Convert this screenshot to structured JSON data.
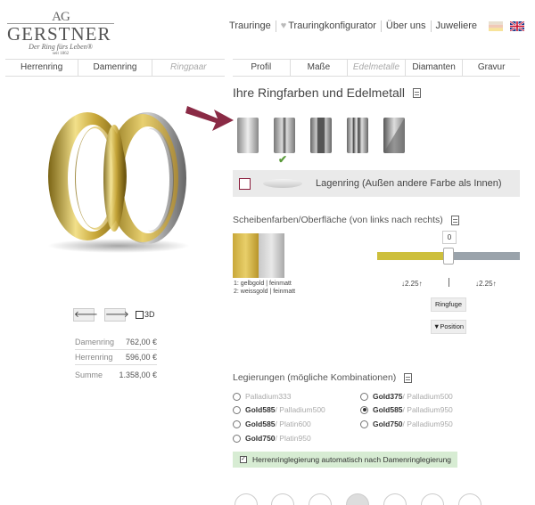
{
  "logo": {
    "monogram": "AG",
    "name": "GERSTNER",
    "tagline": "Der Ring fürs Leben®",
    "since": "seit 1862"
  },
  "topnav": {
    "items": [
      "Trauringe",
      "Trauringkonfigurator",
      "Über uns",
      "Juweliere"
    ]
  },
  "tabs_left": [
    "Herrenring",
    "Damenring",
    "Ringpaar"
  ],
  "tabs_right": [
    "Profil",
    "Maße",
    "Edelmetalle",
    "Diamanten",
    "Gravur"
  ],
  "controls": {
    "left_icon": "arrow-left-icon",
    "right_icon": "arrow-right-icon",
    "threed_label": "3D"
  },
  "prices": [
    {
      "label": "Damenring",
      "value": "762,00 €"
    },
    {
      "label": "Herrenring",
      "value": "596,00 €"
    },
    {
      "label": "Summe",
      "value": "1.358,00 €"
    }
  ],
  "metals": {
    "title": "Ihre Ringfarben und Edelmetall",
    "lagen_label": "Lagenring (Außen andere Farbe als Innen)",
    "disc_title": "Scheibenfarben/Oberfläche (von links nach rechts)",
    "legend": [
      "1: gelbgold | feinmatt",
      "2: weissgold | feinmatt"
    ],
    "slider_value": "0",
    "slider_split_fraction": 0.5,
    "left_width": "↓2.25↑",
    "right_width": "↓2.25↑",
    "ringfuge_label": "Ringfuge",
    "position_label": "▼Position",
    "colors": {
      "gold": "#cdbf3c",
      "white": "#9aa3ab",
      "accent": "#8a1d3c"
    }
  },
  "alloys": {
    "title": "Legierungen (mögliche Kombinationen)",
    "left": [
      {
        "main": "",
        "sec": "Palladium333",
        "selected": false
      },
      {
        "main": "Gold585",
        "sec": " / Palladium500",
        "selected": false
      },
      {
        "main": "Gold585",
        "sec": " / Platin600",
        "selected": false
      },
      {
        "main": "Gold750",
        "sec": " / Platin950",
        "selected": false
      }
    ],
    "right": [
      {
        "main": "Gold375",
        "sec": " / Palladium500",
        "selected": false
      },
      {
        "main": "Gold585",
        "sec": " / Palladium950",
        "selected": true
      },
      {
        "main": "Gold750",
        "sec": " / Palladium950",
        "selected": false
      }
    ],
    "auto_label": "Herrenringlegierung automatisch nach Damenringlegierung"
  }
}
